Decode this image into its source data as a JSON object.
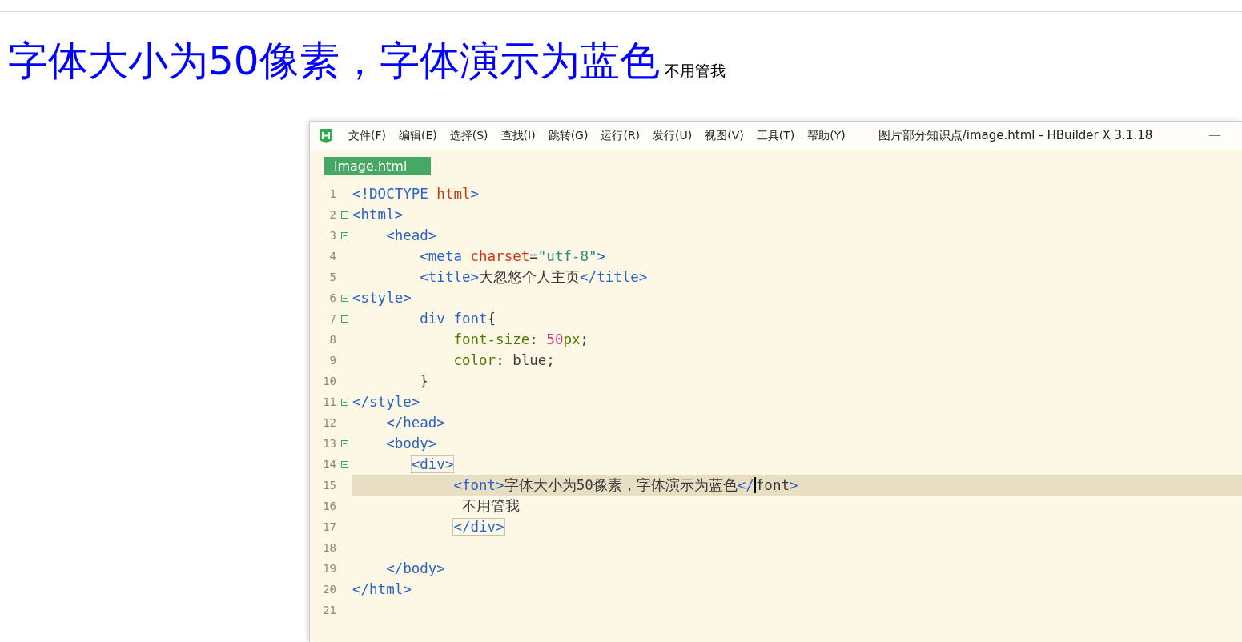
{
  "page": {
    "heading": "字体大小为50像素，字体演示为蓝色",
    "note": "不用管我"
  },
  "editor": {
    "menu": [
      "文件(F)",
      "编辑(E)",
      "选择(S)",
      "查找(I)",
      "跳转(G)",
      "运行(R)",
      "发行(U)",
      "视图(V)",
      "工具(T)",
      "帮助(Y)"
    ],
    "title": "图片部分知识点/image.html - HBuilder X 3.1.18",
    "tabs": [
      {
        "label": "image.html",
        "selected": true
      }
    ],
    "lines": [
      {
        "number": "1",
        "tokens": [
          {
            "kind": "tag",
            "text": "<!DOCTYPE "
          },
          {
            "kind": "attr",
            "text": "html"
          },
          {
            "kind": "tag",
            "text": ">"
          }
        ]
      },
      {
        "number": "2",
        "fold": true,
        "tokens": [
          {
            "kind": "tag",
            "text": "<html>"
          }
        ]
      },
      {
        "number": "3",
        "fold": true,
        "tokens": [
          {
            "kind": "tag",
            "text": "    <head>"
          }
        ]
      },
      {
        "number": "4",
        "tokens": [
          {
            "kind": "tag",
            "text": "        <meta "
          },
          {
            "kind": "attr",
            "text": "charset"
          },
          {
            "kind": "text",
            "text": "="
          },
          {
            "kind": "string",
            "text": "\"utf-8\""
          },
          {
            "kind": "tag",
            "text": ">"
          }
        ]
      },
      {
        "number": "5",
        "tokens": [
          {
            "kind": "tag",
            "text": "        <title>"
          },
          {
            "kind": "text",
            "text": "大忽悠个人主页"
          },
          {
            "kind": "tag",
            "text": "</title>"
          }
        ]
      },
      {
        "number": "6",
        "fold": true,
        "tokens": [
          {
            "kind": "tag",
            "text": "<style>"
          }
        ]
      },
      {
        "number": "7",
        "fold": true,
        "tokens": [
          {
            "kind": "tag",
            "text": "        div font"
          },
          {
            "kind": "text",
            "text": "{"
          }
        ]
      },
      {
        "number": "8",
        "tokens": [
          {
            "kind": "prop",
            "text": "            font-size"
          },
          {
            "kind": "text",
            "text": ": "
          },
          {
            "kind": "number",
            "text": "50"
          },
          {
            "kind": "prop",
            "text": "px"
          },
          {
            "kind": "text",
            "text": ";"
          }
        ]
      },
      {
        "number": "9",
        "tokens": [
          {
            "kind": "prop",
            "text": "            color"
          },
          {
            "kind": "text",
            "text": ": blue;"
          }
        ]
      },
      {
        "number": "10",
        "tokens": [
          {
            "kind": "text",
            "text": "        }"
          }
        ]
      },
      {
        "number": "11",
        "fold": true,
        "tokens": [
          {
            "kind": "tag",
            "text": "</style>"
          }
        ]
      },
      {
        "number": "12",
        "tokens": [
          {
            "kind": "tag",
            "text": "    </head>"
          }
        ]
      },
      {
        "number": "13",
        "fold": true,
        "tokens": [
          {
            "kind": "tag",
            "text": "    <body>"
          }
        ]
      },
      {
        "number": "14",
        "fold": true,
        "tokens": [
          {
            "kind": "tag",
            "text": "       <div>",
            "matched": true
          }
        ]
      },
      {
        "number": "15",
        "current": true,
        "tokens": [
          {
            "kind": "tag",
            "text": "            <font>"
          },
          {
            "kind": "text",
            "text": "字体大小为50像素，字体演示为蓝色"
          },
          {
            "kind": "tag",
            "text": "</"
          },
          {
            "kind": "text",
            "text": "font",
            "caret": true
          },
          {
            "kind": "tag",
            "text": ">"
          }
        ]
      },
      {
        "number": "16",
        "tokens": [
          {
            "kind": "text",
            "text": "             不用管我"
          }
        ]
      },
      {
        "number": "17",
        "tokens": [
          {
            "kind": "tag",
            "text": "            </div>",
            "matched": true
          }
        ]
      },
      {
        "number": "18"
      },
      {
        "number": "19",
        "tokens": [
          {
            "kind": "tag",
            "text": "    </body>"
          }
        ]
      },
      {
        "number": "20",
        "tokens": [
          {
            "kind": "tag",
            "text": "</html>"
          }
        ]
      },
      {
        "number": "21"
      }
    ]
  }
}
